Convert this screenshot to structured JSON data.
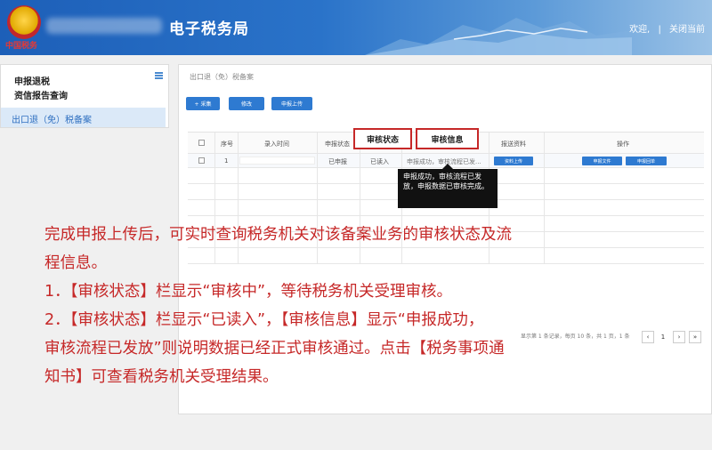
{
  "header": {
    "emblem_text": "中国税务",
    "site_title": "电子税务局",
    "welcome_label": "欢迎,",
    "separator": "|",
    "close_label": "关闭当前"
  },
  "sidebar": {
    "items": [
      "申报退税",
      "资信报告查询"
    ],
    "active_item": "出口退（免）税备案"
  },
  "main": {
    "breadcrumb": "出口退（免）税备案",
    "buttons": [
      "+ 采集",
      "修改",
      "申报上传"
    ],
    "columns": [
      "序号",
      "录入时间",
      "申报状态",
      "审核状态",
      "审核信息",
      "报送资料",
      "操作"
    ],
    "row": {
      "index": "1",
      "declare_status": "已申报",
      "audit_status": "已读入",
      "audit_info": "申报成功，审核流程已发...",
      "upload_btn": "资料上传",
      "doc_btn": "申报文件",
      "receipt_btn": "申报回单"
    },
    "tooltip": "申报成功，审核流程已发放，申报数据已审核完成。",
    "pager_text": "显示第 1 条记录，每页 10 条，共 1 页，1 条",
    "pages": [
      "‹",
      "1",
      "›",
      "»"
    ]
  },
  "note": {
    "lines": [
      "完成申报上传后，可实时查询税务机关对该备案业务的审核状态及流",
      "程信息。",
      "1．【审核状态】栏显示“审核中”，等待税务机关受理审核。",
      "2．【审核状态】栏显示“已读入”，【审核信息】显示“申报成功，",
      "审核流程已发放”则说明数据已经正式审核通过。点击【税务事项通",
      "知书】可查看税务机关受理结果。"
    ]
  }
}
